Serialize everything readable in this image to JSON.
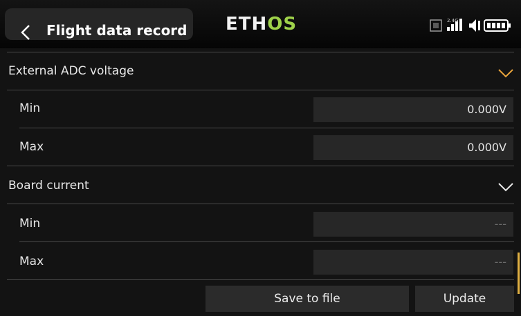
{
  "header": {
    "title": "Flight data record",
    "logo_prefix": "ETH",
    "logo_suffix": "OS",
    "band_label": "2.4G"
  },
  "sections": [
    {
      "label": "External ADC voltage",
      "chevron_color": "#e8a33b",
      "rows": [
        {
          "label": "Min",
          "value": "0.000V"
        },
        {
          "label": "Max",
          "value": "0.000V"
        }
      ]
    },
    {
      "label": "Board current",
      "chevron_color": "#e8e8e8",
      "rows": [
        {
          "label": "Min",
          "value": "---"
        },
        {
          "label": "Max",
          "value": "---"
        }
      ]
    }
  ],
  "buttons": {
    "save": "Save to file",
    "update": "Update"
  },
  "colors": {
    "accent": "#e8a33b",
    "logo_green": "#9fd24a",
    "field_bg": "#272727"
  }
}
